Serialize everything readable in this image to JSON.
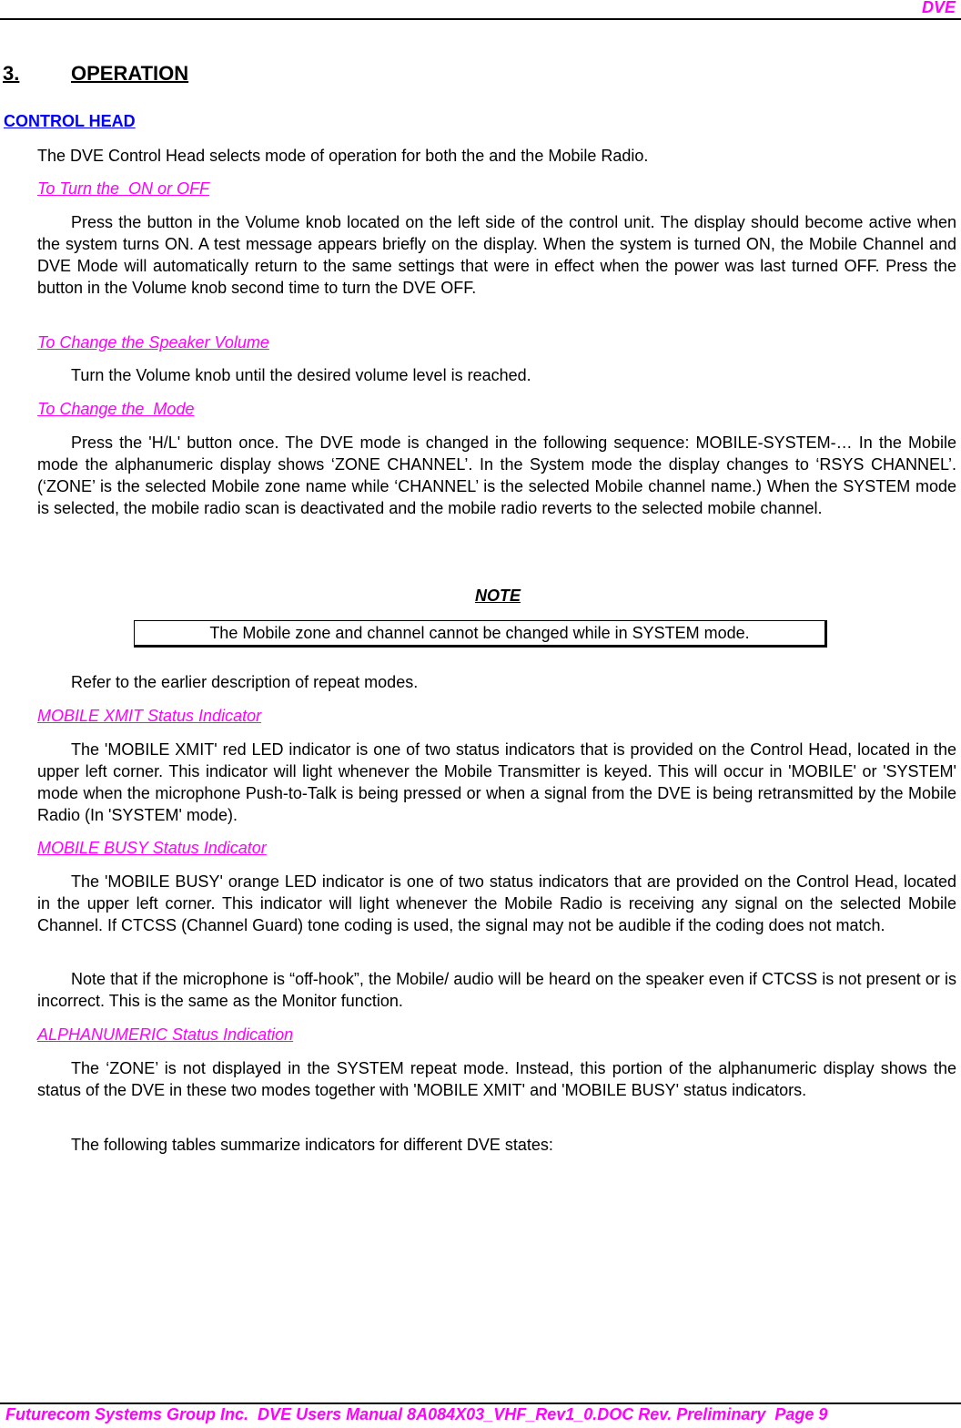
{
  "header": {
    "title": "DVE"
  },
  "chapter": {
    "number": "3.",
    "title": "OPERATION"
  },
  "section": {
    "title": "CONTROL HEAD"
  },
  "intro": "The DVE Control Head selects mode of operation for both the  and the Mobile Radio.",
  "subsections": [
    {
      "title": "To Turn the  ON or OFF",
      "paragraphs": [
        "Press the button in the Volume knob located on the left side of the control unit. The display should become active when the system turns ON. A test message appears briefly on the display. When the system is turned ON, the Mobile Channel and DVE Mode will automatically return to the same settings that were in effect when the power was last turned OFF. Press the button in the Volume knob second time to turn the DVE OFF."
      ]
    },
    {
      "title": "To Change the Speaker Volume",
      "paragraphs": [
        "Turn the Volume knob until the desired volume level is reached."
      ]
    },
    {
      "title": "To Change the  Mode",
      "paragraphs": [
        "Press the 'H/L' button once. The DVE mode is changed in the following sequence: MOBILE-SYSTEM-… In the Mobile mode the alphanumeric display shows ‘ZONE CHANNEL’. In the System mode the display changes to ‘RSYS CHANNEL’. (‘ZONE’ is the selected Mobile zone name while ‘CHANNEL’ is the selected Mobile channel name.) When the SYSTEM mode is selected, the mobile radio scan is deactivated and the mobile radio reverts to the selected mobile channel.",
        "Refer to the earlier description of repeat modes."
      ]
    },
    {
      "title": "MOBILE XMIT Status Indicator",
      "paragraphs": [
        "The 'MOBILE XMIT' red LED indicator is one of two status indicators that is provided on the Control Head, located in the upper left corner. This indicator will light whenever the Mobile Transmitter is keyed. This will occur in 'MOBILE' or 'SYSTEM' mode when the microphone Push-to-Talk is being pressed or when a signal from the DVE is being retransmitted by the Mobile Radio (In 'SYSTEM' mode)."
      ]
    },
    {
      "title": "MOBILE BUSY Status Indicator",
      "paragraphs": [
        "The 'MOBILE BUSY' orange LED indicator is one of two status indicators that are provided on the Control Head, located in the upper left corner. This indicator will light whenever the Mobile Radio is receiving any signal on the selected Mobile Channel. If CTCSS (Channel Guard) tone coding is used, the signal may not be audible if the coding does not match.",
        "Note that if the microphone is “off-hook”, the Mobile/ audio will be heard on the speaker even if CTCSS is not present or is incorrect. This is the same as the Monitor function."
      ]
    },
    {
      "title": "ALPHANUMERIC Status Indication",
      "paragraphs": [
        "The ‘ZONE’ is not displayed in the SYSTEM repeat mode. Instead, this portion of the alphanumeric display shows the status of the DVE in these two modes together with 'MOBILE XMIT' and 'MOBILE BUSY' status indicators.",
        "The following tables summarize indicators for different DVE states:"
      ]
    }
  ],
  "note": {
    "title": "NOTE",
    "text": "The Mobile zone and channel cannot be changed while in SYSTEM mode."
  },
  "footer": {
    "text": "Futurecom Systems Group Inc.  DVE Users Manual 8A084X03_VHF_Rev1_0.DOC Rev. Preliminary  Page 9"
  },
  "colors": {
    "accent_magenta": "#ff00ff",
    "section_blue": "#0000ff",
    "text": "#000000"
  }
}
